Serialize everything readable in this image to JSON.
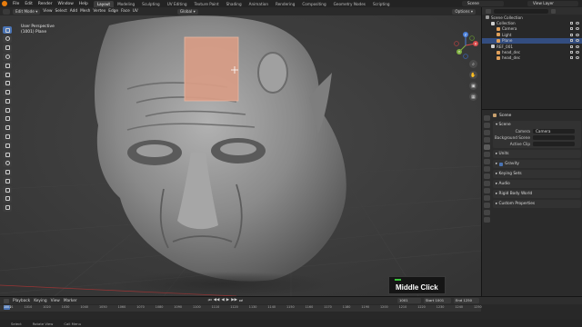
{
  "topbar": {
    "menus": [
      "File",
      "Edit",
      "Render",
      "Window",
      "Help"
    ],
    "workspaces": [
      "Layout",
      "Modeling",
      "Sculpting",
      "UV Editing",
      "Texture Paint",
      "Shading",
      "Animation",
      "Rendering",
      "Compositing",
      "Geometry Nodes",
      "Scripting"
    ],
    "active_workspace": "Layout",
    "scene": "Scene",
    "view_layer": "View Layer"
  },
  "viewport_header": {
    "mode": "Edit Mode",
    "menus": [
      "View",
      "Select",
      "Add",
      "Mesh",
      "Vertex",
      "Edge",
      "Face",
      "UV"
    ],
    "transform_orientation": "Global",
    "options": "Options"
  },
  "viewport_info": {
    "line1": "User Perspective",
    "line2": "(1001) Plane"
  },
  "gizmo_labels": {
    "x": "X",
    "y": "Y",
    "z": "Z"
  },
  "overlay_message": {
    "text": "Middle Click",
    "indicator_color": "#3ac23a"
  },
  "outliner": {
    "items": [
      {
        "label": "Scene Collection",
        "indent": 0,
        "selected": false,
        "color": "#cfcfcf"
      },
      {
        "label": "Collection",
        "indent": 1,
        "selected": false,
        "color": "#cfcfcf"
      },
      {
        "label": "Camera",
        "indent": 2,
        "selected": false,
        "color": "#e0a05a"
      },
      {
        "label": "Light",
        "indent": 2,
        "selected": false,
        "color": "#e0a05a"
      },
      {
        "label": "Plane",
        "indent": 2,
        "selected": true,
        "color": "#e0a05a"
      },
      {
        "label": "REF_001",
        "indent": 1,
        "selected": false,
        "color": "#cfcfcf"
      },
      {
        "label": "head_dec",
        "indent": 2,
        "selected": false,
        "color": "#e0a05a"
      },
      {
        "label": "head_dec",
        "indent": 2,
        "selected": false,
        "color": "#e0a05a"
      }
    ]
  },
  "properties": {
    "title": "Scene",
    "scene_panel": "Scene",
    "fields": [
      {
        "label": "Camera",
        "value": "Camera"
      },
      {
        "label": "Background Scene",
        "value": ""
      },
      {
        "label": "Active Clip",
        "value": ""
      }
    ],
    "panels": [
      "Units",
      "Gravity",
      "Keying Sets",
      "Audio",
      "Rigid Body World",
      "Custom Properties"
    ]
  },
  "timeline": {
    "menus": [
      "Playback",
      "Keying",
      "View",
      "Marker"
    ],
    "current_frame": "1001",
    "start_label": "Start",
    "start": "1001",
    "end_label": "End",
    "end": "1250",
    "ticks": [
      "1001",
      "1010",
      "1020",
      "1030",
      "1040",
      "1050",
      "1060",
      "1070",
      "1080",
      "1090",
      "1100",
      "1110",
      "1120",
      "1130",
      "1140",
      "1150",
      "1160",
      "1170",
      "1180",
      "1190",
      "1200",
      "1210",
      "1220",
      "1230",
      "1240",
      "1250"
    ]
  },
  "statusbar": {
    "items": [
      "Select",
      "Rotate View",
      "Call Menu"
    ]
  },
  "colors": {
    "accent": "#4a74b5",
    "selection_plane": "#d89c86",
    "sculpt": "#8e8e8e"
  }
}
